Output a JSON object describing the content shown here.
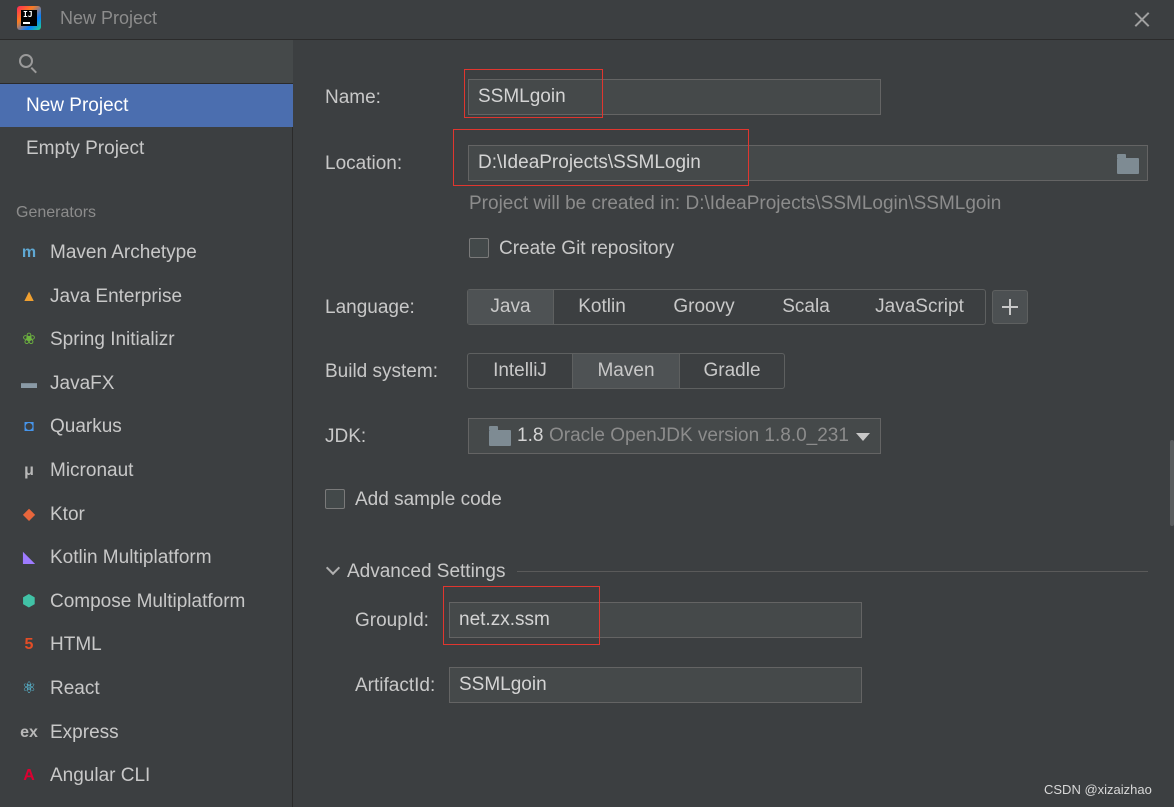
{
  "window": {
    "title": "New Project",
    "app_logo_text": "IJ"
  },
  "sidebar": {
    "search_placeholder": "",
    "top_items": [
      {
        "label": "New Project",
        "selected": true
      },
      {
        "label": "Empty Project",
        "selected": false
      }
    ],
    "generators_header": "Generators",
    "generators": [
      {
        "label": "Maven Archetype",
        "icon": "maven-icon",
        "glyph": "m",
        "color": "#5fa8d3"
      },
      {
        "label": "Java Enterprise",
        "icon": "java-enterprise-icon",
        "glyph": "▲",
        "color": "#f0a030"
      },
      {
        "label": "Spring Initializr",
        "icon": "spring-icon",
        "glyph": "❀",
        "color": "#6db33f"
      },
      {
        "label": "JavaFX",
        "icon": "javafx-folder-icon",
        "glyph": "▬",
        "color": "#8a9aa6"
      },
      {
        "label": "Quarkus",
        "icon": "quarkus-icon",
        "glyph": "◘",
        "color": "#4695eb"
      },
      {
        "label": "Micronaut",
        "icon": "micronaut-icon",
        "glyph": "μ",
        "color": "#b8b8b8"
      },
      {
        "label": "Ktor",
        "icon": "ktor-icon",
        "glyph": "◆",
        "color": "#e8663c"
      },
      {
        "label": "Kotlin Multiplatform",
        "icon": "kotlin-icon",
        "glyph": "◣",
        "color": "#9e7bff"
      },
      {
        "label": "Compose Multiplatform",
        "icon": "compose-icon",
        "glyph": "⬢",
        "color": "#41c2a6"
      },
      {
        "label": "HTML",
        "icon": "html5-icon",
        "glyph": "5",
        "color": "#e44d26"
      },
      {
        "label": "React",
        "icon": "react-icon",
        "glyph": "⚛",
        "color": "#61dafb"
      },
      {
        "label": "Express",
        "icon": "express-icon",
        "glyph": "ex",
        "color": "#b8b8b8"
      },
      {
        "label": "Angular CLI",
        "icon": "angular-icon",
        "glyph": "A",
        "color": "#dd0031"
      }
    ]
  },
  "form": {
    "name_label": "Name:",
    "name_value": "SSMLgoin",
    "location_label": "Location:",
    "location_value": "D:\\IdeaProjects\\SSMLogin",
    "location_hint": "Project will be created in: D:\\IdeaProjects\\SSMLogin\\SSMLgoin",
    "git_label": "Create Git repository",
    "git_checked": false,
    "language_label": "Language:",
    "languages": [
      "Java",
      "Kotlin",
      "Groovy",
      "Scala",
      "JavaScript"
    ],
    "language_selected": "Java",
    "build_label": "Build system:",
    "build_systems": [
      "IntelliJ",
      "Maven",
      "Gradle"
    ],
    "build_selected": "Maven",
    "jdk_label": "JDK:",
    "jdk_version": "1.8",
    "jdk_detail": "Oracle OpenJDK version 1.8.0_231",
    "sample_label": "Add sample code",
    "sample_checked": false,
    "advanced_label": "Advanced Settings",
    "groupid_label": "GroupId:",
    "groupid_value": "net.zx.ssm",
    "artifactid_label": "ArtifactId:",
    "artifactid_value": "SSMLgoin"
  },
  "watermark": "CSDN @xizaizhao",
  "colors": {
    "selection": "#4b6eaf",
    "highlight_box": "#e0362f",
    "background": "#3c3f41"
  }
}
